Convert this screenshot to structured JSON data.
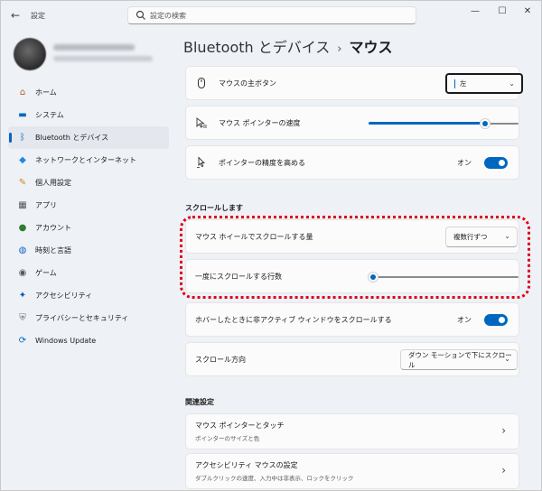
{
  "window": {
    "app_title": "設定",
    "back_icon": "back-arrow-icon",
    "search_placeholder": "設定の検索",
    "controls": {
      "minimize": "—",
      "maximize": "☐",
      "close": "✕"
    }
  },
  "sidebar": {
    "items": [
      {
        "label": "ホーム",
        "icon": "home-icon",
        "glyph": "⌂",
        "color": "#b05a2a",
        "active": false
      },
      {
        "label": "システム",
        "icon": "system-icon",
        "glyph": "▬",
        "color": "#0067c0",
        "active": false
      },
      {
        "label": "Bluetooth とデバイス",
        "icon": "bluetooth-icon",
        "glyph": "ᛒ",
        "color": "#0067c0",
        "active": true
      },
      {
        "label": "ネットワークとインターネット",
        "icon": "network-icon",
        "glyph": "◆",
        "color": "#1e88e5",
        "active": false
      },
      {
        "label": "個人用設定",
        "icon": "personalization-icon",
        "glyph": "✎",
        "color": "#d9822b",
        "active": false
      },
      {
        "label": "アプリ",
        "icon": "apps-icon",
        "glyph": "▦",
        "color": "#555555",
        "active": false
      },
      {
        "label": "アカウント",
        "icon": "account-icon",
        "glyph": "●",
        "color": "#2e7d32",
        "active": false
      },
      {
        "label": "時刻と言語",
        "icon": "time-language-icon",
        "glyph": "◍",
        "color": "#1565c0",
        "active": false
      },
      {
        "label": "ゲーム",
        "icon": "gaming-icon",
        "glyph": "◉",
        "color": "#555555",
        "active": false
      },
      {
        "label": "アクセシビリティ",
        "icon": "accessibility-icon",
        "glyph": "✦",
        "color": "#0b5cad",
        "active": false
      },
      {
        "label": "プライバシーとセキュリティ",
        "icon": "shield-icon",
        "glyph": "⛨",
        "color": "#6d6d6d",
        "active": false
      },
      {
        "label": "Windows Update",
        "icon": "windows-update-icon",
        "glyph": "⟳",
        "color": "#0067c0",
        "active": false
      }
    ]
  },
  "breadcrumb": {
    "parent": "Bluetooth とデバイス",
    "separator": "›",
    "current": "マウス"
  },
  "settings": {
    "primary_button": {
      "label": "マウスの主ボタン",
      "value": "左"
    },
    "pointer_speed": {
      "label": "マウス ポインターの速度",
      "level": 0.78
    },
    "enhance_precision": {
      "label": "ポインターの精度を高める",
      "state": "オン"
    },
    "scroll_section": "スクロールします",
    "wheel_scroll": {
      "label": "マウス ホイールでスクロールする量",
      "value": "複数行ずつ"
    },
    "lines_per_scroll": {
      "label": "一度にスクロールする行数",
      "level": 0.03
    },
    "inactive_scroll": {
      "label": "ホバーしたときに非アクティブ ウィンドウをスクロールする",
      "state": "オン"
    },
    "scroll_direction": {
      "label": "スクロール方向",
      "value": "ダウン モーションで下にスクロール"
    },
    "related_section": "関連設定",
    "related": [
      {
        "title": "マウス ポインターとタッチ",
        "subtitle": "ポインターのサイズと色"
      },
      {
        "title": "アクセシビリティ マウスの設定",
        "subtitle": "ダブルクリックの速度、入力中は非表示、ロックをクリック"
      }
    ]
  },
  "colors": {
    "accent": "#0067c0",
    "highlight": "#e0001a"
  }
}
